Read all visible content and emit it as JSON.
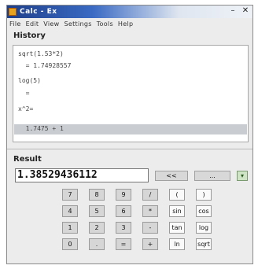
{
  "window": {
    "title": "Calc - Ex"
  },
  "menubar": {
    "items": [
      "File",
      "Edit",
      "View",
      "Settings",
      "Tools",
      "Help"
    ]
  },
  "history": {
    "label": "History",
    "lines": [
      "sqrt(1.53*2)",
      "  = 1.74928557",
      "log(5)",
      "  = ",
      "x^2=",
      "  1.7475 + 1"
    ]
  },
  "result": {
    "label": "Result",
    "value": "1.38529436112",
    "buttons": [
      "<<",
      "..."
    ]
  },
  "keypad": {
    "rows": [
      [
        "7",
        "8",
        "9",
        "/",
        "(",
        ")"
      ],
      [
        "4",
        "5",
        "6",
        "*",
        "sin",
        "cos"
      ],
      [
        "1",
        "2",
        "3",
        "-",
        "tan",
        "log"
      ],
      [
        "0",
        ".",
        "=",
        "+",
        "ln",
        "sqrt"
      ]
    ]
  }
}
